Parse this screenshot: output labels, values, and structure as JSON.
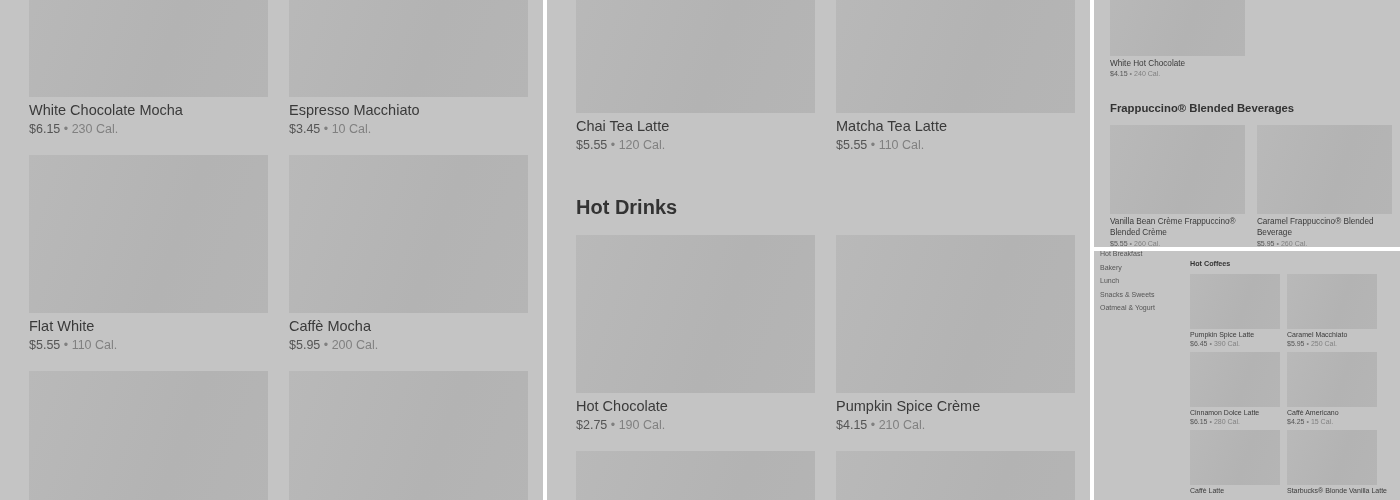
{
  "separator": "•",
  "panels": [
    {
      "sections": [
        {
          "items": [
            {
              "kind": "card",
              "name": "White Chocolate Mocha",
              "price": "$6.15",
              "calories": "230 Cal."
            },
            {
              "kind": "card",
              "name": "Espresso Macchiato",
              "price": "$3.45",
              "calories": "10 Cal."
            },
            {
              "kind": "card",
              "name": "Flat White",
              "price": "$5.55",
              "calories": "110 Cal."
            },
            {
              "kind": "card",
              "name": "Caffè Mocha",
              "price": "$5.95",
              "calories": "200 Cal."
            },
            {
              "kind": "picture"
            },
            {
              "kind": "picture"
            }
          ]
        }
      ]
    },
    {
      "sections": [
        {
          "items": [
            {
              "kind": "card",
              "name": "Chai Tea Latte",
              "price": "$5.55",
              "calories": "120 Cal."
            },
            {
              "kind": "card",
              "name": "Matcha Tea Latte",
              "price": "$5.55",
              "calories": "110 Cal."
            }
          ]
        },
        {
          "heading": "Hot Drinks",
          "items": [
            {
              "kind": "card",
              "name": "Hot Chocolate",
              "price": "$2.75",
              "calories": "190 Cal."
            },
            {
              "kind": "card",
              "name": "Pumpkin Spice Crème",
              "price": "$4.15",
              "calories": "210 Cal."
            },
            {
              "kind": "picture"
            },
            {
              "kind": "picture"
            }
          ]
        }
      ]
    },
    {
      "sections": [
        {
          "items": [
            {
              "kind": "card",
              "name": "White Hot Chocolate",
              "price": "$4.15",
              "calories": "240 Cal."
            }
          ]
        },
        {
          "heading": "Frappuccino® Blended Beverages",
          "items": [
            {
              "kind": "card",
              "name": "Vanilla Bean Crème Frappuccino® Blended Crème",
              "price": "$5.55",
              "calories": "260 Cal."
            },
            {
              "kind": "card",
              "name": "Caramel Frappuccino® Blended Beverage",
              "price": "$5.95",
              "calories": "260 Cal."
            }
          ]
        }
      ]
    },
    {
      "sidebar": [
        "Hot Breakfast",
        "Bakery",
        "Lunch",
        "Snacks & Sweets",
        "Oatmeal & Yogurt"
      ],
      "sections": [
        {
          "heading": "Hot Coffees",
          "items": [
            {
              "kind": "card",
              "name": "Pumpkin Spice Latte",
              "price": "$6.45",
              "calories": "390 Cal."
            },
            {
              "kind": "card",
              "name": "Caramel Macchiato",
              "price": "$5.95",
              "calories": "250 Cal."
            },
            {
              "kind": "card",
              "name": "Cinnamon Dolce Latte",
              "price": "$6.15",
              "calories": "280 Cal."
            },
            {
              "kind": "card",
              "name": "Caffè Americano",
              "price": "$4.25",
              "calories": "15 Cal."
            },
            {
              "kind": "name_only",
              "name": "Caffè Latte"
            },
            {
              "kind": "name_only",
              "name": "Starbucks® Blonde Vanilla Latte"
            }
          ]
        }
      ]
    }
  ]
}
